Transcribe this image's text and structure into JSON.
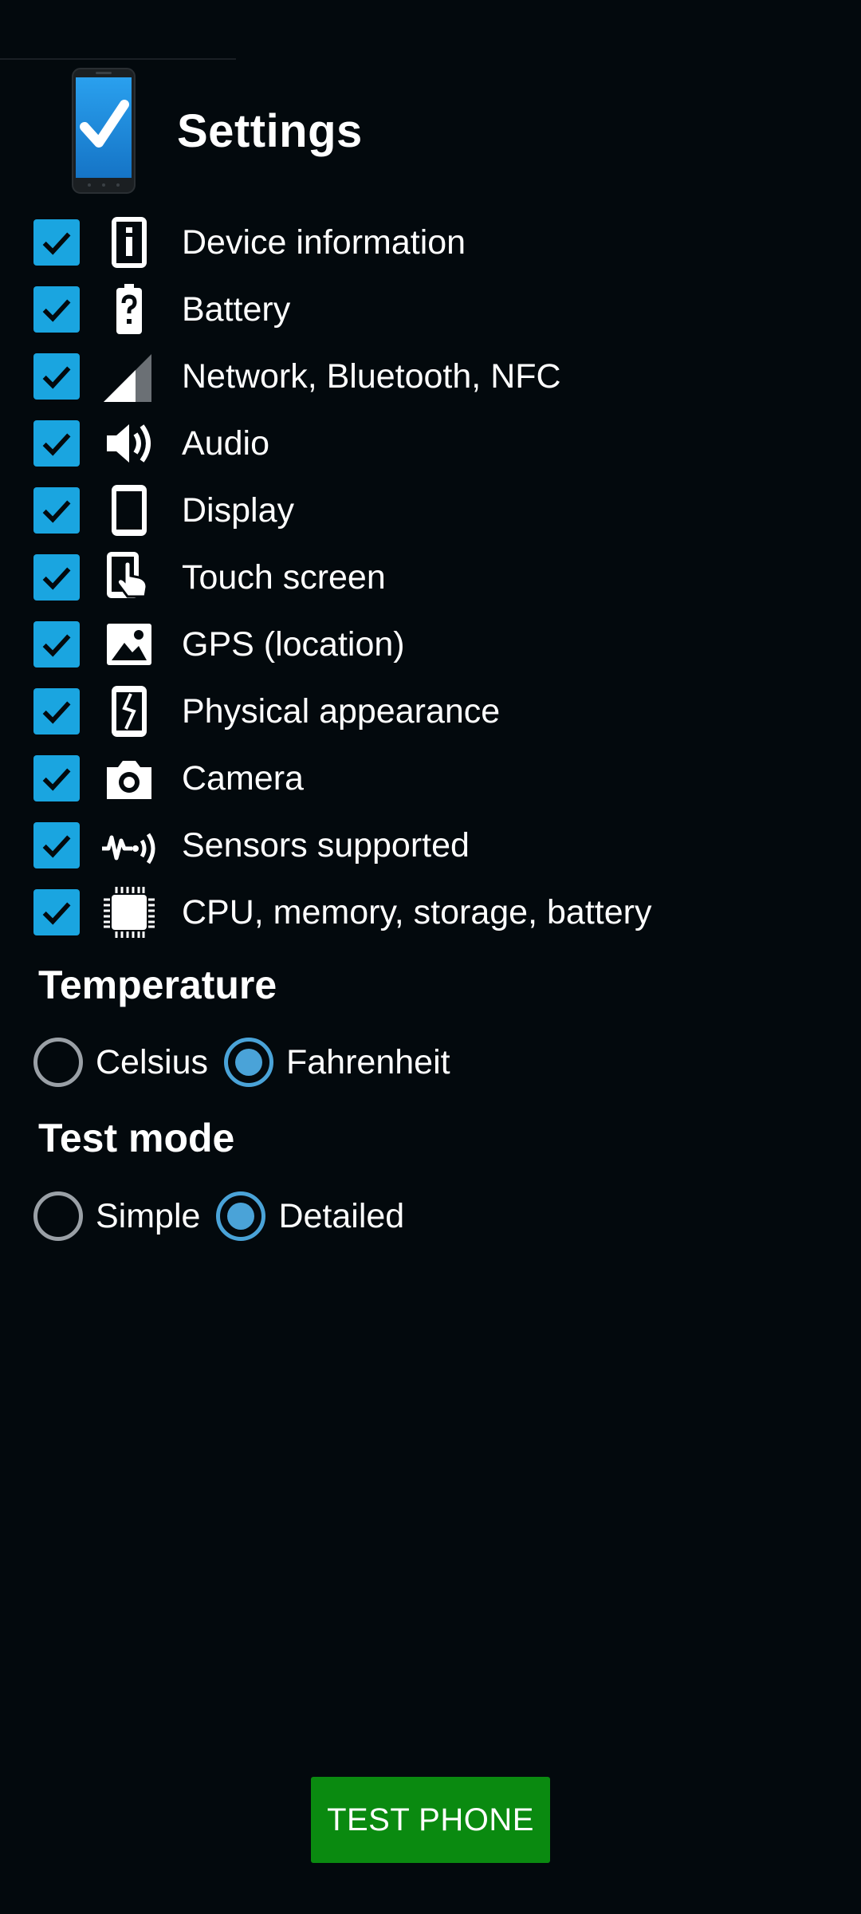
{
  "header": {
    "title": "Settings",
    "logo_icon": "phone-check-icon"
  },
  "colors": {
    "background": "#03090d",
    "checkbox": "#1aa5e0",
    "radio_selected": "#4aa3d8",
    "button": "#0a8a10"
  },
  "tests": [
    {
      "label": "Device information",
      "icon": "info-icon",
      "checked": true
    },
    {
      "label": "Battery",
      "icon": "battery-icon",
      "checked": true
    },
    {
      "label": "Network, Bluetooth, NFC",
      "icon": "signal-icon",
      "checked": true
    },
    {
      "label": "Audio",
      "icon": "speaker-icon",
      "checked": true
    },
    {
      "label": "Display",
      "icon": "display-icon",
      "checked": true
    },
    {
      "label": "Touch screen",
      "icon": "touch-icon",
      "checked": true
    },
    {
      "label": "GPS (location)",
      "icon": "image-icon",
      "checked": true
    },
    {
      "label": "Physical appearance",
      "icon": "broken-phone-icon",
      "checked": true
    },
    {
      "label": "Camera",
      "icon": "camera-icon",
      "checked": true
    },
    {
      "label": "Sensors supported",
      "icon": "sensor-icon",
      "checked": true
    },
    {
      "label": "CPU, memory, storage, battery",
      "icon": "chip-icon",
      "checked": true
    }
  ],
  "temperature": {
    "title": "Temperature",
    "options": [
      {
        "label": "Celsius",
        "selected": false
      },
      {
        "label": "Fahrenheit",
        "selected": true
      }
    ]
  },
  "test_mode": {
    "title": "Test mode",
    "options": [
      {
        "label": "Simple",
        "selected": false
      },
      {
        "label": "Detailed",
        "selected": true
      }
    ]
  },
  "action": {
    "button_label": "TEST PHONE"
  }
}
